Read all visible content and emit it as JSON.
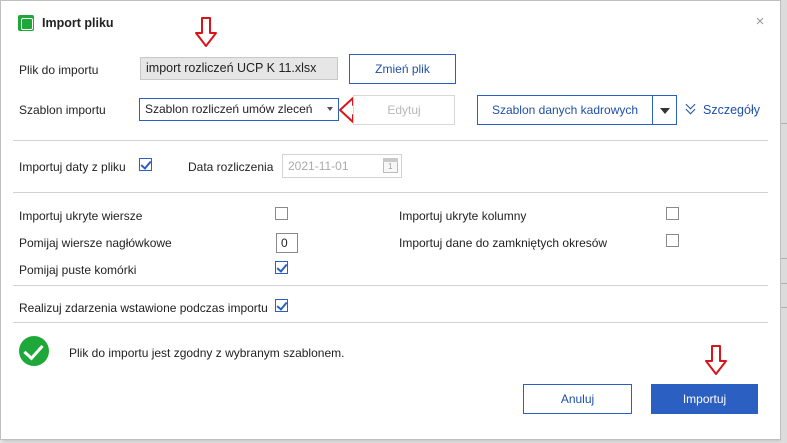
{
  "dialog": {
    "title": "Import pliku",
    "title_icon": "import-file-icon",
    "close_glyph": "×"
  },
  "file": {
    "label": "Plik do importu",
    "value": "import rozliczeń UCP K 11.xlsx",
    "change_button": "Zmień plik"
  },
  "template": {
    "label": "Szablon importu",
    "selected": "Szablon rozliczeń umów zleceń",
    "edit_button": "Edytuj",
    "hr_template_button": "Szablon danych kadrowych",
    "details_link": "Szczegóły"
  },
  "dates": {
    "import_dates_label": "Importuj daty z pliku",
    "import_dates_checked": true,
    "settlement_date_label": "Data rozliczenia",
    "settlement_date_value": "2021-11-01"
  },
  "options": {
    "hidden_rows_label": "Importuj ukryte wiersze",
    "hidden_rows_checked": false,
    "hidden_columns_label": "Importuj ukryte kolumny",
    "hidden_columns_checked": false,
    "skip_header_rows_label": "Pomijaj wiersze nagłówkowe",
    "skip_header_rows_value": "0",
    "closed_periods_label": "Importuj dane do zamkniętych okresów",
    "closed_periods_checked": false,
    "skip_empty_cells_label": "Pomijaj puste komórki",
    "skip_empty_cells_checked": true
  },
  "events": {
    "label": "Realizuj zdarzenia wstawione podczas importu",
    "checked": true
  },
  "status": {
    "icon": "success-check-icon",
    "text": "Plik do importu jest zgodny z wybranym szablonem."
  },
  "footer": {
    "cancel_button": "Anuluj",
    "import_button": "Importuj"
  },
  "colors": {
    "accent": "#2b5fc1",
    "success": "#1fa83a",
    "annotation": "#d9141b"
  }
}
